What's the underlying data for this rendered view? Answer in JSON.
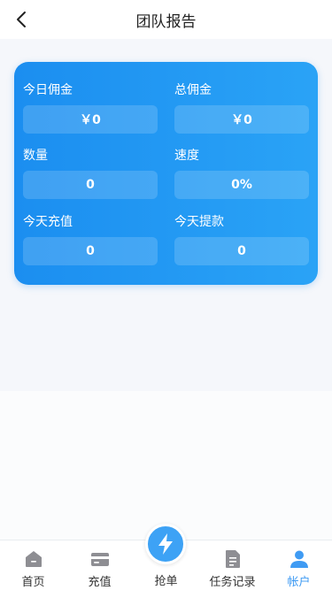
{
  "header": {
    "title": "团队报告"
  },
  "stats": [
    {
      "label": "今日佣金",
      "value": "￥0"
    },
    {
      "label": "总佣金",
      "value": "￥0"
    },
    {
      "label": "数量",
      "value": "0"
    },
    {
      "label": "速度",
      "value": "0%"
    },
    {
      "label": "今天充值",
      "value": "0"
    },
    {
      "label": "今天提款",
      "value": "0"
    }
  ],
  "tabbar": {
    "items": [
      {
        "label": "首页",
        "icon": "home-icon"
      },
      {
        "label": "充值",
        "icon": "card-icon"
      },
      {
        "label": "抢单",
        "icon": "lightning-icon"
      },
      {
        "label": "任务记录",
        "icon": "document-icon"
      },
      {
        "label": "帐户",
        "icon": "user-icon"
      }
    ],
    "active": "帐户"
  },
  "colors": {
    "accent": "#3da2f5",
    "card_start": "#1b8ef0",
    "card_end": "#2aa3f6",
    "inactive_icon": "#8e8e93"
  }
}
